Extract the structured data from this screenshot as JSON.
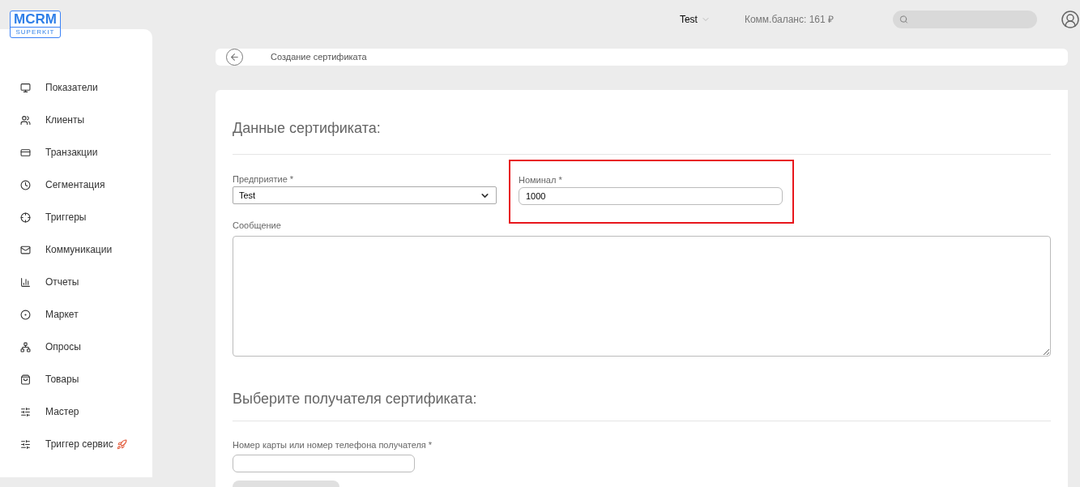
{
  "logo": {
    "title": "MCRM",
    "subtitle": "SUPERKIT"
  },
  "header": {
    "company": "Test",
    "balance": "Комм.баланс: 161 ₽"
  },
  "sidebar": {
    "items": [
      {
        "label": "Показатели"
      },
      {
        "label": "Клиенты"
      },
      {
        "label": "Транзакции"
      },
      {
        "label": "Сегментация"
      },
      {
        "label": "Триггеры"
      },
      {
        "label": "Коммуникации"
      },
      {
        "label": "Отчеты"
      },
      {
        "label": "Маркет"
      },
      {
        "label": "Опросы"
      },
      {
        "label": "Товары"
      },
      {
        "label": "Мастер"
      },
      {
        "label": "Триггер сервис"
      }
    ]
  },
  "breadcrumb": {
    "title": "Создание сертификата"
  },
  "certificate_section": {
    "heading": "Данные сертификата:",
    "enterprise": {
      "label": "Предприятие *",
      "value": "Test"
    },
    "nominal": {
      "label": "Номинал *",
      "value": "1000",
      "highlighted": true
    },
    "message": {
      "label": "Сообщение"
    }
  },
  "recipient_section": {
    "heading": "Выберите получателя сертификата:",
    "recipient": {
      "label": "Номер карты или номер телефона получателя *"
    }
  }
}
